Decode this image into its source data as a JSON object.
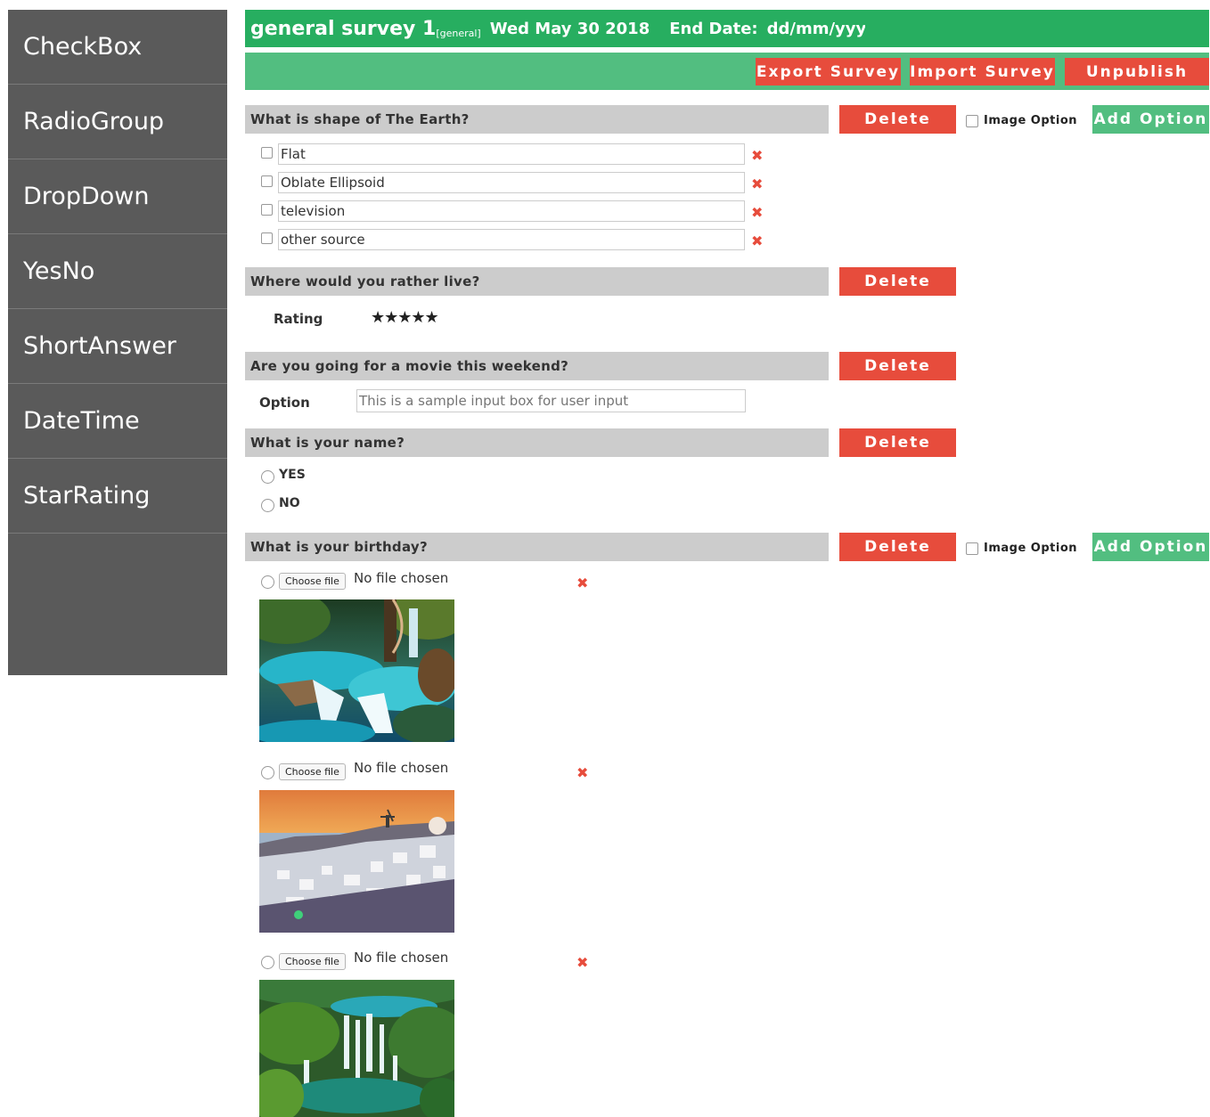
{
  "sidebar": {
    "items": [
      {
        "label": "CheckBox"
      },
      {
        "label": "RadioGroup"
      },
      {
        "label": "DropDown"
      },
      {
        "label": "YesNo"
      },
      {
        "label": "ShortAnswer"
      },
      {
        "label": "DateTime"
      },
      {
        "label": "StarRating"
      }
    ]
  },
  "header": {
    "survey_name": "general survey 1",
    "survey_tag": "[general]",
    "date": "Wed May 30 2018",
    "end_date_label": "End Date:",
    "end_date_placeholder": "dd/mm/yyyy"
  },
  "toolbar": {
    "export_label": "Export Survey",
    "import_label": "Import Survey",
    "unpublish_label": "Unpublish"
  },
  "common": {
    "delete_label": "Delete",
    "image_option_label": "Image Option",
    "add_option_label": "Add Option",
    "remove_icon": "✖",
    "choose_file_label": "Choose file",
    "no_file_text": "No file chosen"
  },
  "questions": [
    {
      "title": "What is shape of The Earth?",
      "type": "checkbox",
      "options": [
        "Flat",
        "Oblate Ellipsoid",
        "television",
        "other source"
      ]
    },
    {
      "title": "Where would you rather live?",
      "type": "star-rating",
      "rating_label": "Rating",
      "stars": "★★★★★",
      "max_stars": 5
    },
    {
      "title": "Are you going for a movie this weekend?",
      "type": "short-answer",
      "option_label": "Option",
      "input_placeholder": "This is a sample input box for user input"
    },
    {
      "title": "What is your name?",
      "type": "yes-no",
      "options": [
        "YES",
        "NO"
      ]
    },
    {
      "title": "What is your birthday?",
      "type": "image-radio",
      "image_options": [
        {
          "image": "waterfall-turquoise-pools"
        },
        {
          "image": "santorini-sunset-village"
        },
        {
          "image": "forest-waterfalls-lake"
        }
      ]
    }
  ],
  "colors": {
    "sidebar_bg": "#5a5a5a",
    "title_bar": "#27ae60",
    "toolbar": "#52be80",
    "danger": "#e74c3c",
    "question_header": "#cccccc"
  }
}
